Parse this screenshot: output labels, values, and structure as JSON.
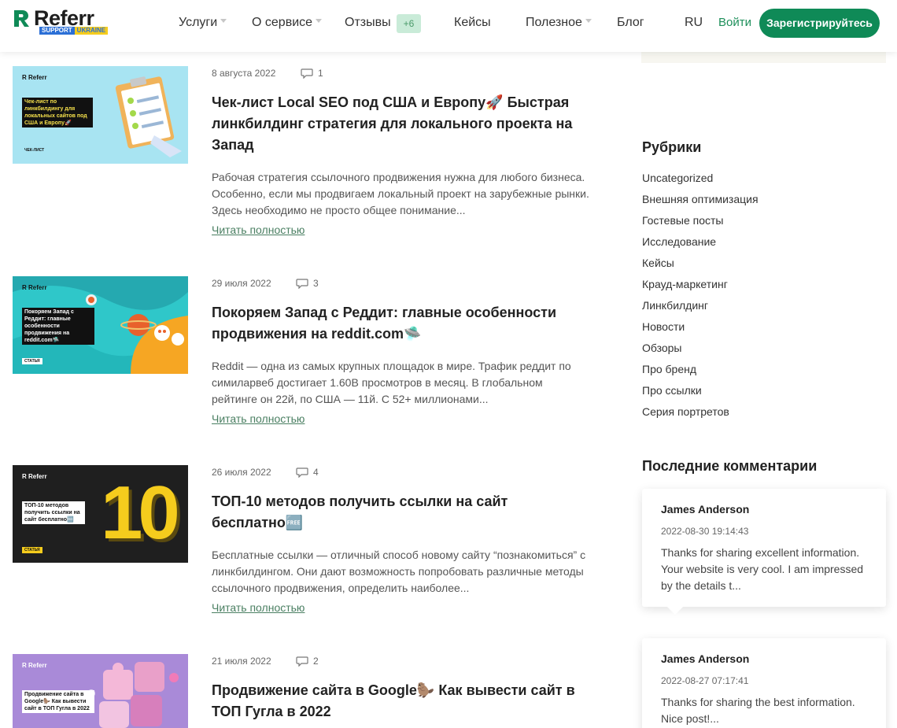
{
  "header": {
    "logo_text": "Referr",
    "logo_sub_1": "SUPPORT",
    "logo_sub_2": "UKRAINE",
    "nav": [
      {
        "label": "Услуги"
      },
      {
        "label": "О сервисе"
      },
      {
        "label": "Отзывы"
      },
      {
        "label": "Кейсы"
      },
      {
        "label": "Полезное"
      },
      {
        "label": "Блог"
      },
      {
        "label": "RU"
      }
    ],
    "reviews_badge": "+6",
    "login_label": "Войти",
    "register_label": "Зарегистрируйтесь",
    "brand_color": "#0f8a57"
  },
  "read_more_label": "Читать полностью",
  "posts": [
    {
      "date": "8 августа 2022",
      "comments": "1",
      "title": "Чек-лист Local SEO под США и Европу🚀 Быстрая линкбилдинг стратегия для локального проекта на Запад",
      "excerpt": "Рабочая стратегия ссылочного продвижения нужна для любого бизнеса. Особенно, если мы продвигаем локальный проект на зарубежные рынки. Здесь необходимо не просто общее понимание...",
      "thumb_logo": "R Referr",
      "thumb_caption": "Чек-лист по линкбилдингу для локальных сайтов под США и Европу🚀",
      "thumb_tag": "ЧЕК-ЛИСТ"
    },
    {
      "date": "29 июля 2022",
      "comments": "3",
      "title": "Покоряем Запад с Реддит: главные особенности продвижения на reddit.com🛸",
      "excerpt": "Reddit — одна из самых крупных площадок в мире. Трафик реддит по симиларвеб достигает 1.60B просмотров в месяц. В глобальном рейтинге он 22й, по США — 11й. С 52+ миллионами...",
      "thumb_logo": "R Referr",
      "thumb_caption": "Покоряем Запад с Реддит: главные особенности продвижения на reddit.com🛸",
      "thumb_tag": "СТАТЬЯ"
    },
    {
      "date": "26 июля 2022",
      "comments": "4",
      "title": "ТОП-10 методов получить ссылки на сайт бесплатно🆓",
      "excerpt": "Бесплатные ссылки — отличный способ новому сайту “познакомиться” с линкбилдингом. Они дают возможность попробовать различные методы ссылочного продвижения, определить наиболее...",
      "thumb_logo": "R Referr",
      "thumb_caption": "ТОП-10 методов получить ссылки на сайт бесплатно🆓",
      "thumb_tag": "СТАТЬЯ",
      "thumb_number": "10"
    },
    {
      "date": "21 июля 2022",
      "comments": "2",
      "title": "Продвижение сайта в Google🦫 Как вывести сайт в ТОП Гугла в 2022",
      "excerpt": "",
      "thumb_logo": "R Referr",
      "thumb_caption": "Продвижение сайта в Google🦫 Как вывести сайт в ТОП Гугла в 2022"
    }
  ],
  "sidebar": {
    "categories_heading": "Рубрики",
    "categories": [
      "Uncategorized",
      "Внешняя оптимизация",
      "Гостевые посты",
      "Исследование",
      "Кейсы",
      "Крауд-маркетинг",
      "Линкбилдинг",
      "Новости",
      "Обзоры",
      "Про бренд",
      "Про ссылки",
      "Серия портретов"
    ],
    "comments_heading": "Последние комментарии",
    "comments": [
      {
        "author": "James Anderson",
        "date": "2022-08-30 19:14:43",
        "text": "Thanks for sharing excellent information. Your website is very cool. I am impressed by the details t..."
      },
      {
        "author": "James Anderson",
        "date": "2022-08-27 07:17:41",
        "text": "Thanks for sharing the best information. Nice post!..."
      }
    ]
  }
}
